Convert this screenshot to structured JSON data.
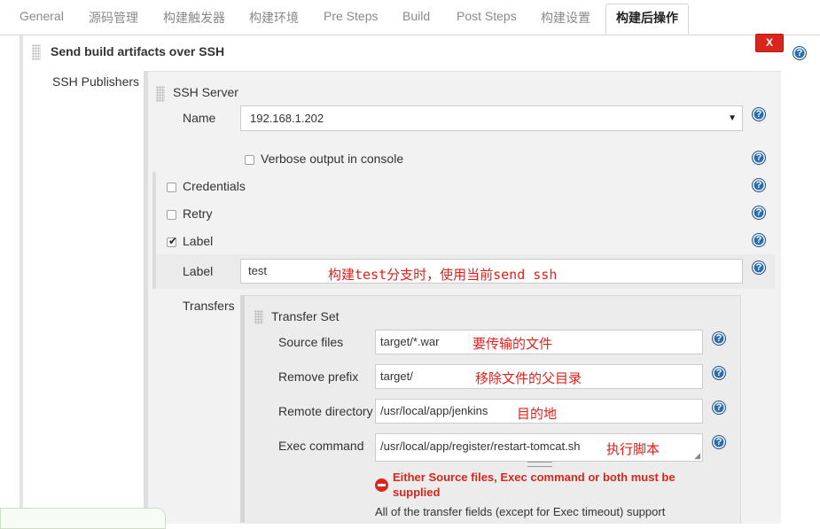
{
  "tabs": [
    "General",
    "源码管理",
    "构建触发器",
    "构建环境",
    "Pre Steps",
    "Build",
    "Post Steps",
    "构建设置",
    "构建后操作"
  ],
  "active_tab": "构建后操作",
  "section": {
    "title": "Send build artifacts over SSH",
    "delete_label": "X",
    "publishers_label": "SSH Publishers"
  },
  "ssh_server": {
    "title": "SSH Server",
    "name_label": "Name",
    "name_value": "192.168.1.202",
    "verbose_label": "Verbose output in console",
    "verbose_checked": false,
    "credentials_label": "Credentials",
    "retry_label": "Retry",
    "label_checkbox_label": "Label",
    "label_checked": true,
    "label_field_label": "Label",
    "label_value": "test",
    "label_note": "构建test分支时，使用当前send ssh"
  },
  "transfers": {
    "label": "Transfers",
    "set_title": "Transfer Set",
    "source_files_label": "Source files",
    "source_files_value": "target/*.war",
    "source_files_note": "要传输的文件",
    "remove_prefix_label": "Remove prefix",
    "remove_prefix_value": "target/",
    "remove_prefix_note": "移除文件的父目录",
    "remote_dir_label": "Remote directory",
    "remote_dir_value": "/usr/local/app/jenkins",
    "remote_dir_note": "目的地",
    "exec_label": "Exec command",
    "exec_value": "/usr/local/app/register/restart-tomcat.sh",
    "exec_note": "执行脚本",
    "error_text": "Either Source files, Exec command or both must be supplied",
    "info_text": "All of the transfer fields (except for Exec timeout) support"
  },
  "help_glyph": "?",
  "colors": {
    "error": "#d9261c",
    "help": "#2a6db0",
    "note": "#e0201a"
  }
}
